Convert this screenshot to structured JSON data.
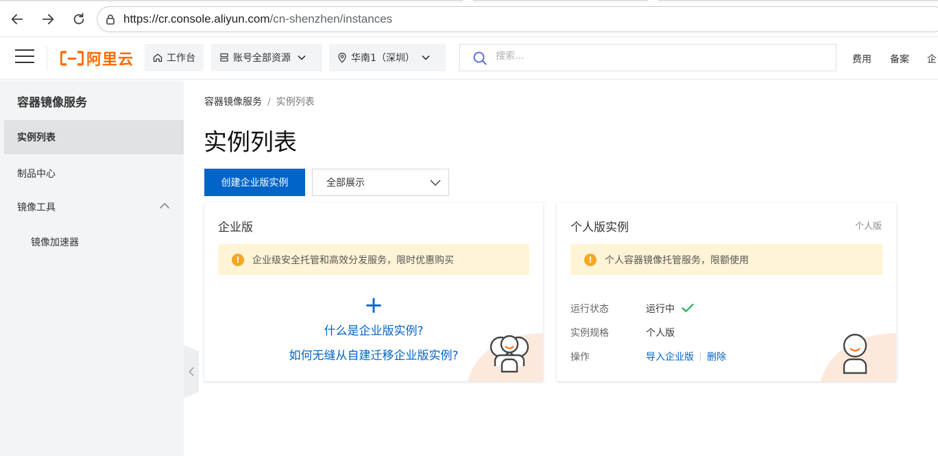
{
  "browser": {
    "url_host": "https://cr.console.aliyun.com",
    "url_path": "/cn-shenzhen/instances"
  },
  "header": {
    "logo_text": "阿里云",
    "workbench": "工作台",
    "resources": "账号全部资源",
    "region": "华南1（深圳）",
    "search_placeholder": "搜索...",
    "links": [
      "费用",
      "备案",
      "企"
    ]
  },
  "sidebar": {
    "title": "容器镜像服务",
    "items": [
      {
        "label": "实例列表"
      },
      {
        "label": "制品中心"
      },
      {
        "label": "镜像工具"
      },
      {
        "label": "镜像加速器"
      }
    ]
  },
  "main": {
    "breadcrumb": [
      "容器镜像服务",
      "实例列表"
    ],
    "breadcrumb_sep": "/",
    "page_title": "实例列表",
    "create_button": "创建企业版实例",
    "filter_select": "全部展示"
  },
  "enterprise_card": {
    "title": "企业版",
    "notice": "企业级安全托管和高效分发服务，限时优惠购买",
    "plus": "+",
    "link1": "什么是企业版实例?",
    "link2": "如何无缝从自建迁移企业版实例?"
  },
  "personal_card": {
    "title": "个人版实例",
    "tag": "个人版",
    "notice": "个人容器镜像托管服务，限额使用",
    "status_label": "运行状态",
    "status_value": "运行中",
    "spec_label": "实例规格",
    "spec_value": "个人版",
    "ops_label": "操作",
    "op_import": "导入企业版",
    "op_delete": "删除"
  },
  "colors": {
    "primary": "#0064c8",
    "brand": "#ff6a00",
    "notice_bg": "#fff4d6",
    "success": "#1fae5a"
  }
}
